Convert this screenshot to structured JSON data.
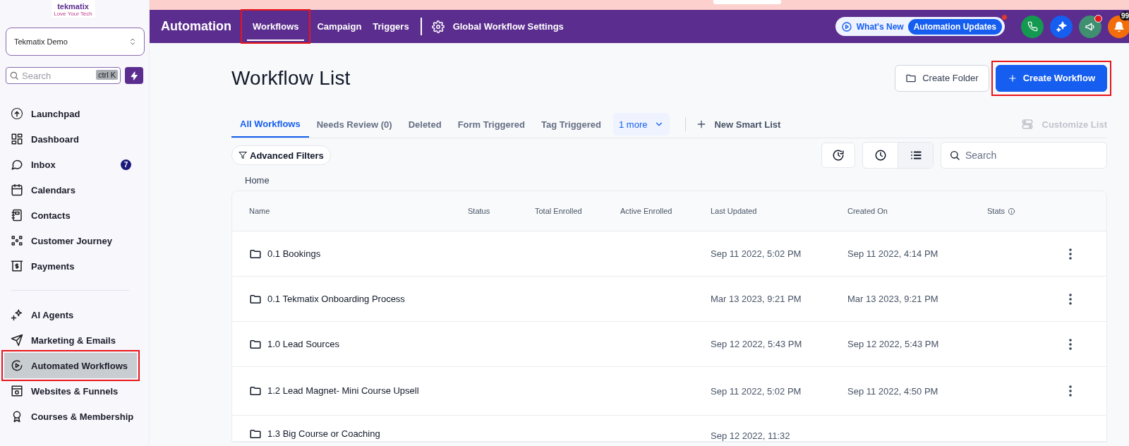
{
  "sidebar": {
    "logo": {
      "name": "tekmatix",
      "tagline": "Love Your Tech"
    },
    "account": "Tekmatix Demo",
    "search": {
      "placeholder": "Search",
      "shortcut": "ctrl K"
    },
    "items": [
      {
        "kind": "link",
        "label": "Launchpad",
        "selected": false,
        "highlighted": false
      },
      {
        "kind": "link",
        "label": "Dashboard",
        "selected": false,
        "highlighted": false
      },
      {
        "kind": "link",
        "label": "Inbox",
        "selected": false,
        "highlighted": false,
        "badge": "7"
      },
      {
        "kind": "link",
        "label": "Calendars",
        "selected": false,
        "highlighted": false
      },
      {
        "kind": "link",
        "label": "Contacts",
        "selected": false,
        "highlighted": false
      },
      {
        "kind": "link",
        "label": "Customer Journey",
        "selected": false,
        "highlighted": false
      },
      {
        "kind": "link",
        "label": "Payments",
        "selected": false,
        "highlighted": false
      },
      {
        "kind": "divider"
      },
      {
        "kind": "link",
        "label": "AI Agents",
        "selected": false,
        "highlighted": false
      },
      {
        "kind": "link",
        "label": "Marketing & Emails",
        "selected": false,
        "highlighted": false
      },
      {
        "kind": "link",
        "label": "Automated Workflows",
        "selected": true,
        "highlighted": true
      },
      {
        "kind": "link",
        "label": "Websites & Funnels",
        "selected": false,
        "highlighted": false
      },
      {
        "kind": "link",
        "label": "Courses & Membership",
        "selected": false,
        "highlighted": false
      }
    ]
  },
  "header": {
    "title": "Automation",
    "tabs": [
      {
        "label": "Workflows",
        "selected": true,
        "highlighted": true
      },
      {
        "label": "Campaign",
        "selected": false,
        "highlighted": false
      },
      {
        "label": "Triggers",
        "selected": false,
        "highlighted": false
      }
    ],
    "settings": "Global Workflow Settings",
    "whats_new": {
      "label": "What's New",
      "pill": "Automation Updates"
    },
    "notification_count": "99"
  },
  "page": {
    "title": "Workflow List",
    "buttons": [
      {
        "label": "Create Folder",
        "kind": "secondary",
        "highlighted": false
      },
      {
        "label": "Create Workflow",
        "kind": "primary",
        "highlighted": true
      }
    ],
    "lists": [
      {
        "label": "All Workflows",
        "selected": true
      },
      {
        "label": "Needs Review (0)",
        "selected": false
      },
      {
        "label": "Deleted",
        "selected": false
      },
      {
        "label": "Form Triggered",
        "selected": false
      },
      {
        "label": "Tag Triggered",
        "selected": false
      }
    ],
    "more": "1 more",
    "new_list": "New Smart List",
    "customize": {
      "label": "Customize List",
      "disabled": true
    },
    "filters": "Advanced Filters",
    "view_toggles": [
      {
        "selected": false
      },
      {
        "selected": true
      }
    ],
    "search": {
      "placeholder": "Search"
    },
    "breadcrumb": "Home",
    "table": {
      "columns": [
        "Name",
        "Status",
        "Total Enrolled",
        "Active Enrolled",
        "Last Updated",
        "Created On",
        "Stats"
      ],
      "rows": [
        {
          "name": "0.1 Bookings",
          "last_updated": "Sep 11 2022, 5:02 PM",
          "created_on": "Sep 11 2022, 4:14 PM"
        },
        {
          "name": "0.1 Tekmatix Onboarding Process",
          "last_updated": "Mar 13 2023, 9:21 PM",
          "created_on": "Mar 13 2023, 9:21 PM"
        },
        {
          "name": "1.0 Lead Sources",
          "last_updated": "Sep 12 2022, 5:43 PM",
          "created_on": "Sep 12 2022, 5:43 PM"
        },
        {
          "name": "1.2 Lead Magnet- Mini Course Upsell",
          "last_updated": "Sep 11 2022, 5:02 PM",
          "created_on": "Sep 11 2022, 4:50 PM"
        },
        {
          "name": "1.3 Big Course or Coaching",
          "last_updated": "Sep 12 2022, 11:32"
        }
      ]
    }
  }
}
